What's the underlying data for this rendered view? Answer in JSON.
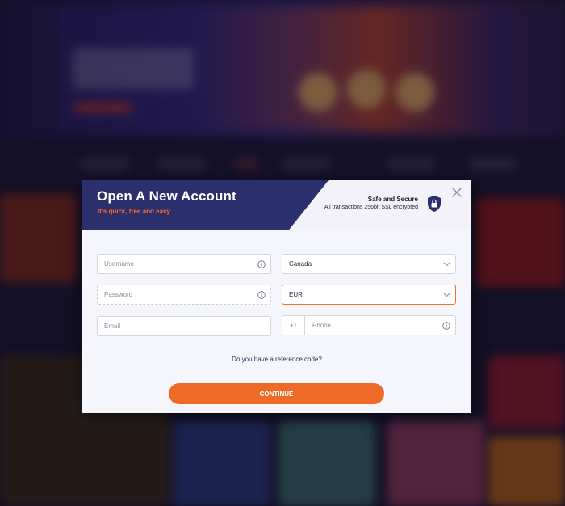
{
  "modal": {
    "title": "Open A New Account",
    "subtitle": "It's quick, free and easy",
    "secure_title": "Safe and Secure",
    "secure_subtitle": "All transactions 256bit SSL encrypted",
    "lock_icon": "lock-shield-icon",
    "close_icon": "close-icon"
  },
  "form": {
    "username": {
      "placeholder": "Username",
      "value": ""
    },
    "password": {
      "placeholder": "Password",
      "value": ""
    },
    "email": {
      "placeholder": "Email",
      "value": ""
    },
    "country": {
      "value": "Canada"
    },
    "currency": {
      "value": "EUR"
    },
    "phone": {
      "prefix": "+1",
      "placeholder": "Phone",
      "value": ""
    },
    "reference_link": "Do you have a reference code?",
    "continue_label": "CONTINUE"
  },
  "colors": {
    "header_banner": "#2b2f6b",
    "accent_orange": "#f06a27",
    "subtitle_orange": "#ff6b2b",
    "active_border": "#e9762e"
  }
}
